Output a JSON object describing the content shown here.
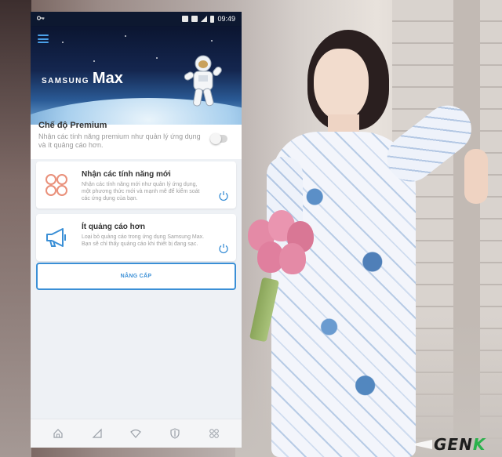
{
  "status_bar": {
    "time": "09:49",
    "icons": [
      "key-icon",
      "alarm-icon",
      "nfc-icon",
      "signal-icon",
      "battery-icon"
    ]
  },
  "app": {
    "brand_small": "SAMSUNG",
    "brand_large": "Max"
  },
  "premium": {
    "title": "Chế độ Premium",
    "description": "Nhận các tính năng premium như quản lý ứng dụng và ít quảng cáo hơn.",
    "enabled": false
  },
  "cards": [
    {
      "title": "Nhận các tính năng mới",
      "description": "Nhận các tính năng mới như quản lý ứng dụng, một phương thức mới và mạnh mẽ để kiểm soát các ứng dụng của bạn.",
      "icon": "grid-circles-icon"
    },
    {
      "title": "Ít quảng cáo hơn",
      "description": "Loại bỏ quảng cáo trong ứng dụng Samsung Max. Bạn sẽ chỉ thấy quảng cáo khi thiết bị đang sạc.",
      "icon": "megaphone-icon"
    }
  ],
  "cta": {
    "label": "NÂNG CẤP"
  },
  "bottom_nav": [
    "home-icon",
    "data-saver-icon",
    "wifi-icon",
    "privacy-shield-icon",
    "apps-icon"
  ],
  "watermark": {
    "text": "GEN",
    "accent": "K"
  },
  "colors": {
    "accent_blue": "#3a8fd6",
    "icon_orange": "#e9907a",
    "icon_blue": "#3a8fd6"
  }
}
